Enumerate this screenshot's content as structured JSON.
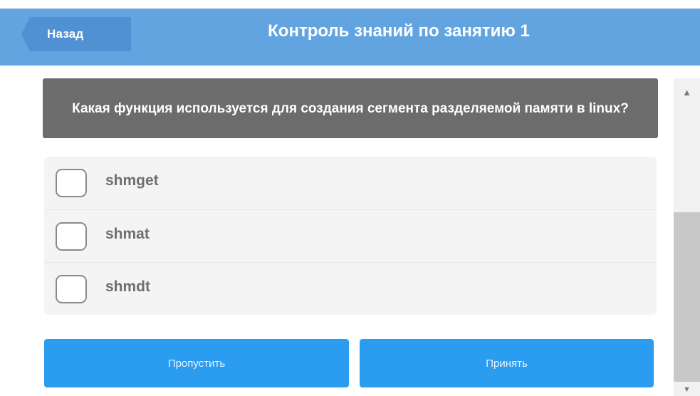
{
  "header": {
    "back_label": "Назад",
    "title": "Контроль знаний по занятию 1"
  },
  "question": {
    "text": "Какая функция используется для создания сегмента разделяемой памяти в linux?"
  },
  "options": [
    {
      "label": "shmget",
      "checked": false
    },
    {
      "label": "shmat",
      "checked": false
    },
    {
      "label": "shmdt",
      "checked": false
    }
  ],
  "buttons": {
    "skip_label": "Пропустить",
    "accept_label": "Принять"
  },
  "scrollbar": {
    "up_icon": "▲",
    "down_icon": "▼"
  },
  "colors": {
    "header": "#62a4e0",
    "back_button": "#4f91d3",
    "question_bg": "#6c6c6c",
    "button": "#2b9df0"
  }
}
